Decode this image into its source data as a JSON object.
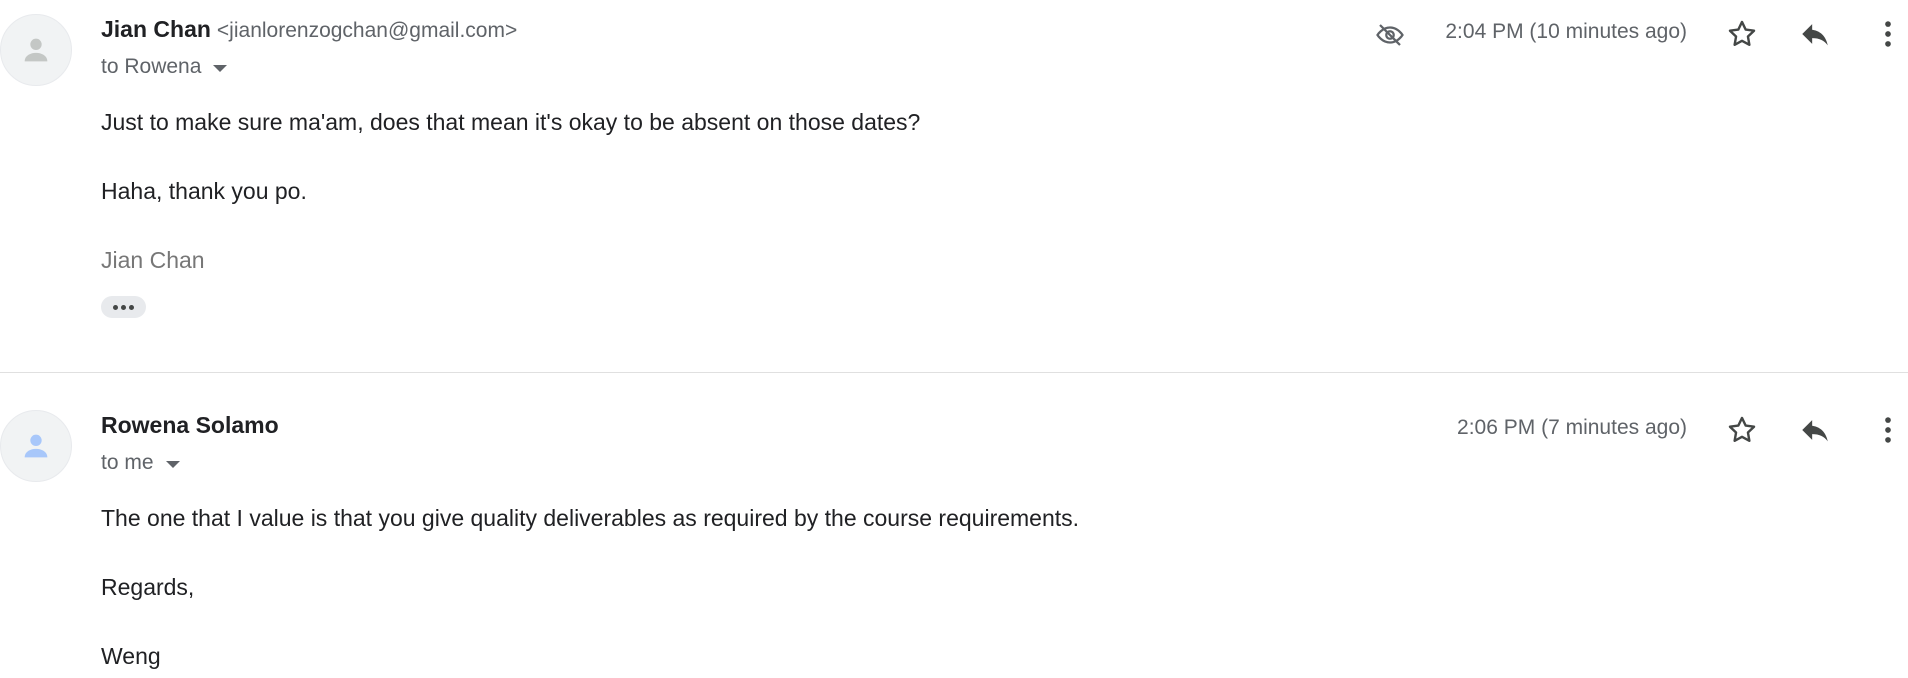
{
  "messages": [
    {
      "sender_name": "Jian Chan",
      "sender_email": "<jianlorenzogchan@gmail.com>",
      "to": "to Rowena",
      "timestamp": "2:04 PM (10 minutes ago)",
      "body": [
        "Just to make sure ma'am, does that mean it's okay to be absent on those dates?",
        "Haha, thank you po."
      ],
      "signature": "Jian Chan",
      "avatar_color": "#c4c7c5",
      "icons": [
        "hidden-eye-icon",
        "star-icon",
        "reply-icon",
        "more-vert-icon"
      ]
    },
    {
      "sender_name": "Rowena Solamo",
      "to": "to me",
      "timestamp": "2:06 PM (7 minutes ago)",
      "body": [
        "The one that I value is that you give quality deliverables as required by the course requirements.",
        "Regards,",
        "Weng"
      ],
      "avatar_color": "#a8c7fa",
      "icons": [
        "star-icon",
        "reply-icon",
        "more-vert-icon"
      ]
    }
  ],
  "colors": {
    "text_primary": "#202124",
    "text_secondary": "#5f6368",
    "signature": "#777777",
    "divider": "#e0e0e0"
  }
}
